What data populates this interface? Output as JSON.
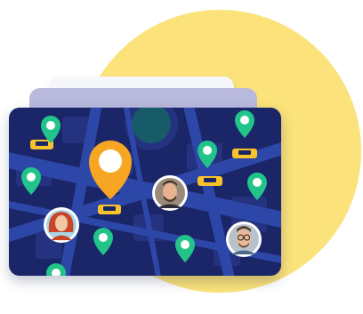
{
  "scene": {
    "background": "#ffffff",
    "sun_color": "#fbe27a",
    "card_colors": {
      "map": "#1a2667",
      "roads": "#2d47a8",
      "blocks": "#24327f",
      "park": "#175a68",
      "back_card_1": "#b9b9de",
      "back_card_2": "#f6f7fb"
    },
    "pin_color": "#22c48a",
    "main_pin_color": "#f6a623",
    "taxi_color": "#f8c22a"
  },
  "markers": {
    "green_pins": 9,
    "taxis": 5,
    "avatars": [
      "woman-red-hair-avatar",
      "man-beard-avatar",
      "man-glasses-avatar"
    ],
    "icon_names": [
      "location-pin-icon",
      "taxi-icon",
      "avatar"
    ]
  }
}
